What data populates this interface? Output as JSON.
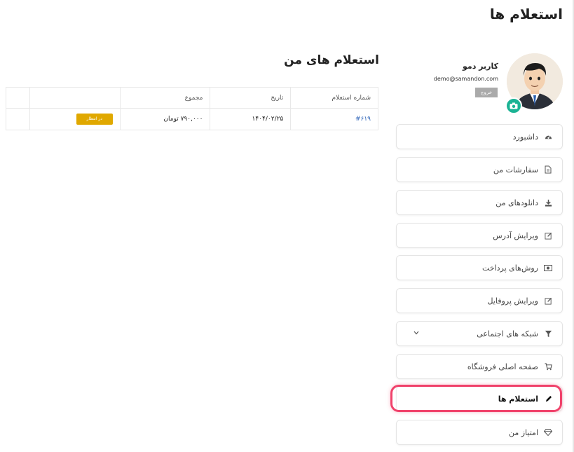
{
  "page": {
    "title": "استعلام ها"
  },
  "profile": {
    "name": "کاربر دمو",
    "email": "demo@samandon.com",
    "logout_label": "خروج"
  },
  "menu": [
    {
      "label": "داشبورد",
      "icon": "dashboard-icon"
    },
    {
      "label": "سفارشات من",
      "icon": "document-icon"
    },
    {
      "label": "دانلودهای من",
      "icon": "download-icon"
    },
    {
      "label": "ویرایش آدرس",
      "icon": "edit-icon"
    },
    {
      "label": "روش‌های پرداخت",
      "icon": "money-icon"
    },
    {
      "label": "ویرایش پروفایل",
      "icon": "edit-icon"
    },
    {
      "label": "شبکه های اجتماعی",
      "icon": "filter-icon"
    },
    {
      "label": "صفحه اصلی فروشگاه",
      "icon": "cart-icon"
    },
    {
      "label": "استعلام ها",
      "icon": "pencil-icon",
      "active": true
    },
    {
      "label": "امتیاز من",
      "icon": "diamond-icon"
    }
  ],
  "main": {
    "title": "استعلام های من",
    "columns": [
      "شماره استعلام",
      "تاریخ",
      "مجموع",
      "",
      ""
    ],
    "rows": [
      {
        "number": "#۶۱۹",
        "date": "۱۴۰۴/۰۲/۲۵",
        "total": "۷۹۰,۰۰۰ تومان",
        "status": "در انتظار"
      }
    ]
  },
  "colors": {
    "accent": "#1bb394",
    "highlight": "#f0426b",
    "status_pending": "#e0a800",
    "link": "#2d63b8"
  }
}
